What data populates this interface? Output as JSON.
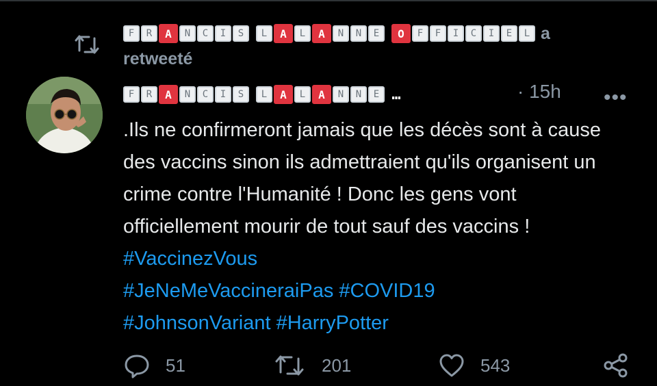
{
  "retweet": {
    "name_tiles": [
      "F",
      "R",
      "A",
      "N",
      "C",
      "I",
      "S",
      " ",
      "L",
      "A",
      "L",
      "A",
      "N",
      "N",
      "E",
      " ",
      "O",
      "F",
      "F",
      "I",
      "C",
      "I",
      "E",
      "L"
    ],
    "name_red": [
      2,
      9,
      11,
      16
    ],
    "suffix": "a",
    "line2": "retweeté"
  },
  "tweet": {
    "name_tiles": [
      "F",
      "R",
      "A",
      "N",
      "C",
      "I",
      "S",
      " ",
      "L",
      "A",
      "L",
      "A",
      "N",
      "N",
      "E"
    ],
    "name_red": [
      2,
      9,
      11
    ],
    "ellipsis": "…",
    "time": "· 15h",
    "more": "•••",
    "body_text": ".Ils ne confirmeront jamais que les décès sont à cause des vaccins sinon ils admettraient qu'ils organisent un crime contre l'Humanité ! Donc les gens vont officiellement mourir de tout sauf des vaccins !",
    "hashtags": [
      "#VaccinezVous",
      "#JeNeMeVaccineraiPas",
      "#COVID19",
      "#JohnsonVariant",
      "#HarryPotter"
    ]
  },
  "actions": {
    "reply_count": "51",
    "retweet_count": "201",
    "like_count": "543"
  },
  "colors": {
    "background": "#000000",
    "text": "#e7e9ea",
    "muted": "#8b98a5",
    "link": "#1d9bf0",
    "tile_red": "#e0343f"
  },
  "icons": [
    "retweet-icon",
    "reply-icon",
    "like-icon",
    "share-icon",
    "more-icon"
  ]
}
